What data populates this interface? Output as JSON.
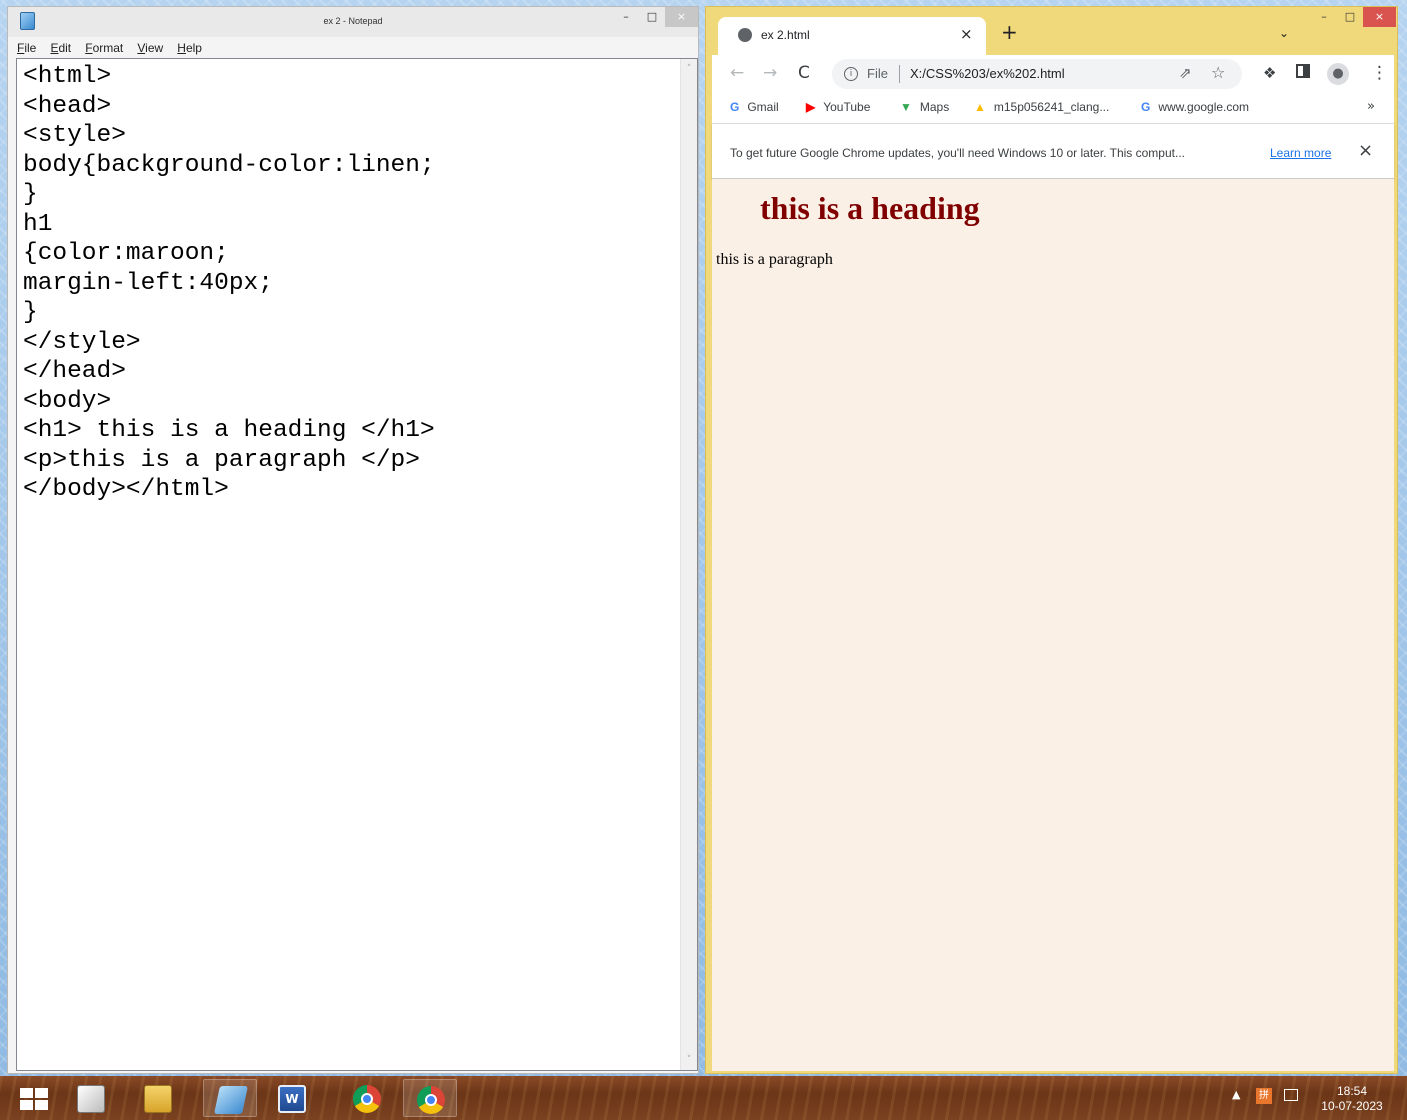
{
  "notepad": {
    "title": "ex 2 - Notepad",
    "controls": {
      "minimize": "–",
      "maximize": "□",
      "close": "×"
    },
    "menu": [
      "File",
      "Edit",
      "Format",
      "View",
      "Help"
    ],
    "content": "<html>\n<head>\n<style>\nbody{background-color:linen;\n}\nh1\n{color:maroon;\nmargin-left:40px;\n}\n</style>\n</head>\n<body>\n<h1> this is a heading </h1>\n<p>this is a paragraph </p>\n</body></html>",
    "scroll_up": "˄",
    "scroll_down": "˅"
  },
  "chrome": {
    "tab_title": "ex 2.html",
    "tab_close": "×",
    "new_tab": "+",
    "tab_search": "⌄",
    "controls": {
      "minimize": "–",
      "maximize": "□",
      "close": "×"
    },
    "nav": {
      "back": "←",
      "forward": "→",
      "reload": "C"
    },
    "omnibox": {
      "info": "i",
      "scheme": "File",
      "url": "X:/CSS%203/ex%202.html",
      "share": "⇗",
      "star": "☆"
    },
    "toolbar": {
      "extensions": "❖",
      "profile": "●",
      "menu": "⋮"
    },
    "bookmarks": [
      {
        "icon": "G",
        "label": "Gmail",
        "color": "#4285f4"
      },
      {
        "icon": "▶",
        "label": "YouTube",
        "color": "#ff0000"
      },
      {
        "icon": "▼",
        "label": "Maps",
        "color": "#34a853"
      },
      {
        "icon": "▲",
        "label": "m15p056241_clang...",
        "color": "#fbbc04"
      },
      {
        "icon": "G",
        "label": "www.google.com",
        "color": "#4285f4"
      }
    ],
    "bookmarks_more": "»",
    "infobar": {
      "message": "To get future Google Chrome updates, you'll need Windows 10 or later. This comput...",
      "link": "Learn more",
      "close": "×"
    },
    "page": {
      "heading": "this is a heading",
      "paragraph": "this is a paragraph",
      "background": "#faf0e6",
      "heading_color": "#800000"
    }
  },
  "taskbar": {
    "word_icon": "W",
    "tray_arrow": "▲",
    "ime": "拼",
    "time": "18:54",
    "date": "10-07-2023"
  }
}
